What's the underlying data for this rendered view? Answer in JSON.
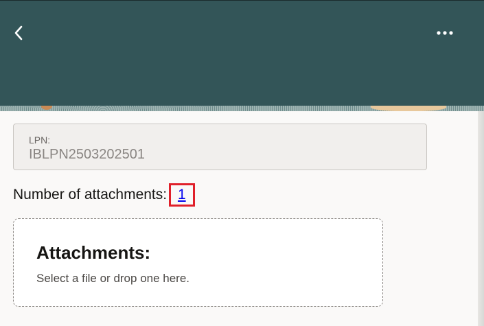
{
  "header": {
    "back_icon": "chevron-left-icon",
    "more_icon": "ellipsis-icon",
    "colors": {
      "header_bg": "#335558",
      "link": "#0000ee",
      "highlight": "#e0202a"
    }
  },
  "lpn": {
    "label": "LPN:",
    "value": "IBLPN2503202501"
  },
  "attachments_count": {
    "label": "Number of attachments:",
    "value": "1"
  },
  "dropzone": {
    "title": "Attachments:",
    "subtitle": "Select a file or drop one here."
  }
}
